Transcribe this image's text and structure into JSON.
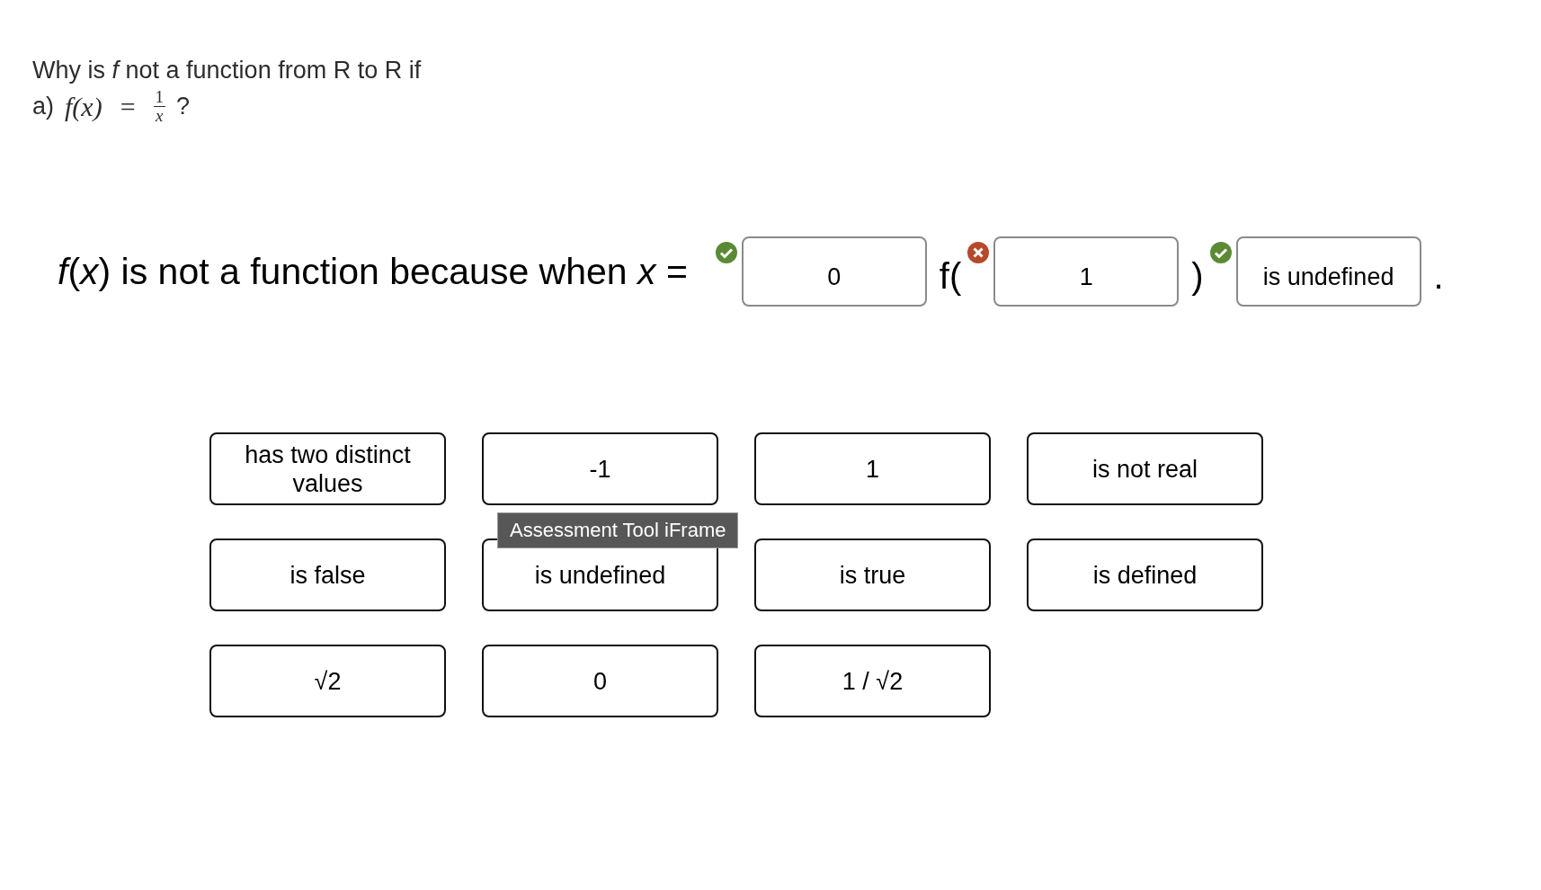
{
  "question": {
    "text": "Why is *f* not a function from R to R if",
    "part_label": "a)",
    "formula": {
      "lhs": "f(x)",
      "relation": "=",
      "numerator": "1",
      "denominator": "x"
    },
    "end_mark": "?"
  },
  "sentence": {
    "lead": "*f*(*x*) is not a function because when *x* =",
    "parts": [
      {
        "kind": "blank",
        "value": "0",
        "correct": true
      },
      {
        "kind": "text",
        "value": "f("
      },
      {
        "kind": "blank",
        "value": "1",
        "correct": false
      },
      {
        "kind": "text",
        "value": ")"
      },
      {
        "kind": "blank",
        "value": "is undefined",
        "correct": true
      },
      {
        "kind": "text",
        "value": "."
      }
    ]
  },
  "choices": [
    {
      "label": "has two distinct values"
    },
    {
      "label": "-1"
    },
    {
      "label": "1"
    },
    {
      "label": "is not real"
    },
    {
      "label": "is false"
    },
    {
      "label": "is undefined"
    },
    {
      "label": "is true"
    },
    {
      "label": "is defined"
    },
    {
      "label": "√2"
    },
    {
      "label": "0"
    },
    {
      "label": "1 / √2"
    }
  ],
  "tooltip": "Assessment Tool iFrame"
}
